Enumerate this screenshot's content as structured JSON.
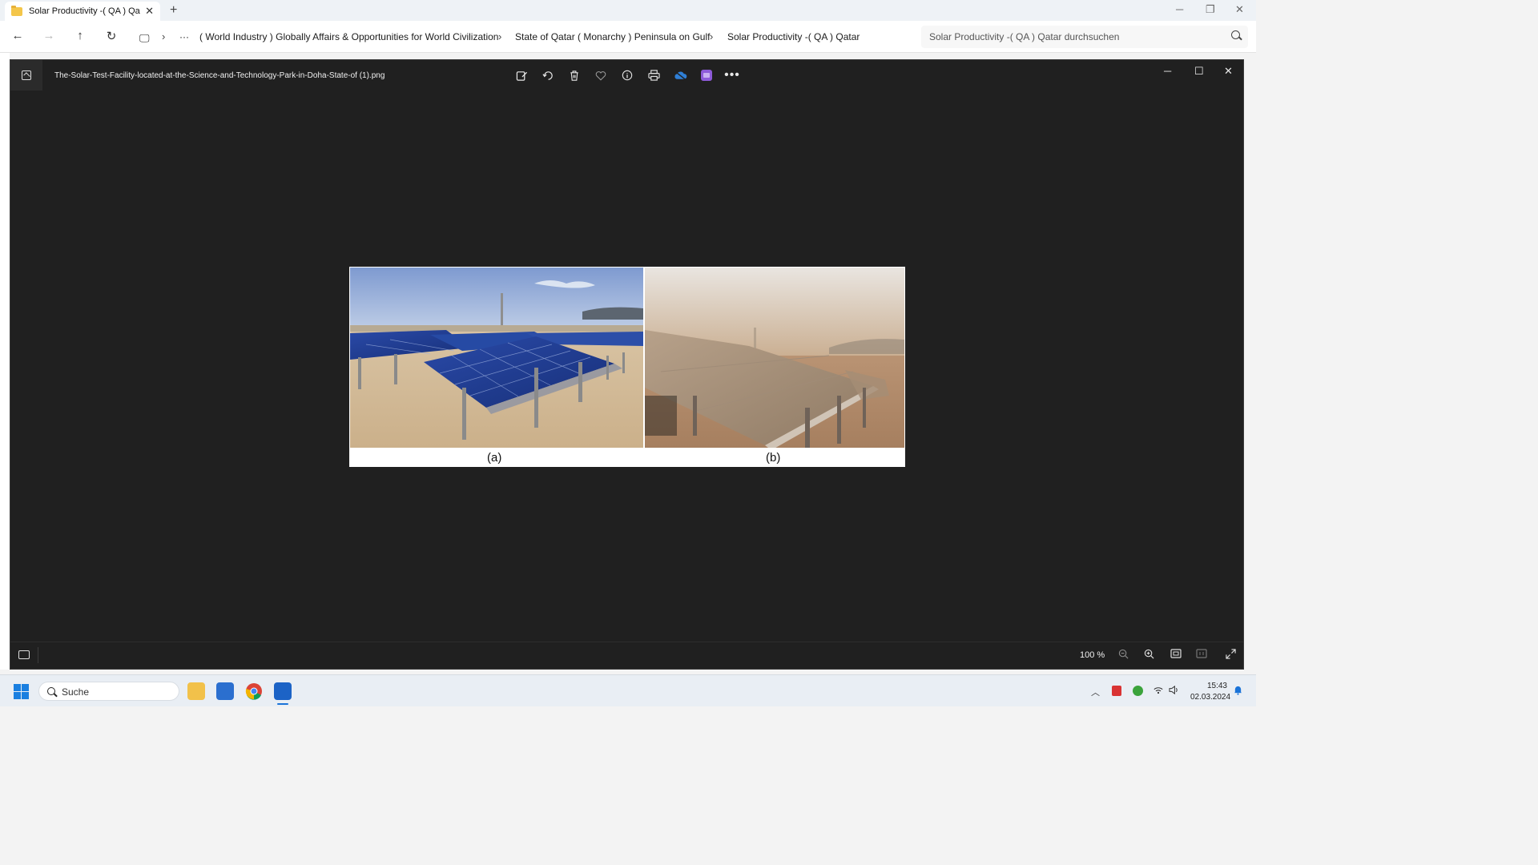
{
  "explorer": {
    "tab_title": "Solar Productivity -( QA ) Qata",
    "tab_close": "✕",
    "new_tab": "+",
    "window_controls": {
      "minimize": "─",
      "restore": "❐",
      "close": "✕"
    },
    "nav": {
      "back": "←",
      "forward": "→",
      "up": "↑",
      "refresh": "↻",
      "pc": "🖵",
      "more": "···",
      "chevron": "›"
    },
    "breadcrumb": [
      "( World Industry ) Globally Affairs & Opportunities for World Civilization",
      "State of Qatar ( Monarchy )  Peninsula on Gulf",
      "Solar Productivity -( QA ) Qatar"
    ],
    "search_placeholder": "Solar Productivity -( QA ) Qatar durchsuchen"
  },
  "viewer": {
    "file_name": "The-Solar-Test-Facility-located-at-the-Science-and-Technology-Park-in-Doha-State-of (1).png",
    "toolbar": [
      "edit-icon",
      "rotate-icon",
      "delete-icon",
      "favorite-icon",
      "info-icon",
      "print-icon",
      "onedrive-icon",
      "clipchamp-icon",
      "more-icon"
    ],
    "window_controls": {
      "minimize": "─",
      "maximize": "☐",
      "close": "✕"
    },
    "image": {
      "caption_a": "(a)",
      "caption_b": "(b)"
    },
    "footer": {
      "zoom_level": "100 %",
      "icons": [
        "zoom-out-icon",
        "zoom-in-icon",
        "fit-icon",
        "actual-size-icon",
        "fullscreen-icon"
      ]
    }
  },
  "taskbar": {
    "search_label": "Suche",
    "apps": [
      "file-explorer-icon",
      "store-icon",
      "chrome-icon",
      "photos-icon"
    ],
    "time": "15:43",
    "date": "02.03.2024",
    "tray": [
      "chevron-up-icon",
      "pdf-icon",
      "security-icon",
      "wifi-icon",
      "volume-icon",
      "notification-icon"
    ]
  },
  "colors": {
    "viewer_bg": "#202020",
    "accent": "#1a7fe0",
    "panel_blue": "#1f3a8a"
  }
}
